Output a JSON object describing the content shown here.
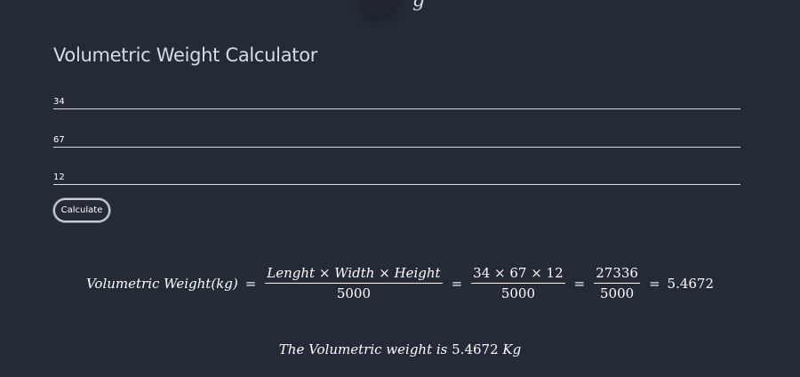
{
  "header": {
    "logo_glyph": "g"
  },
  "calculator": {
    "title": "Volumetric Weight Calculator",
    "inputs": [
      {
        "value": "34"
      },
      {
        "value": "67"
      },
      {
        "value": "12"
      }
    ],
    "button_label": "Calculate"
  },
  "formula": {
    "lhs": "Volumetric Weight(kg)",
    "eq": "=",
    "frac1_num": "Lenght × Width × Height",
    "frac1_den": "5000",
    "frac2_num": "34 × 67 × 12",
    "frac2_den": "5000",
    "frac3_num": "27336",
    "frac3_den": "5000",
    "result": "5.4672"
  },
  "result_line": {
    "prefix": "The Volumetric weight is ",
    "value": "5.4672",
    "unit": " Kg"
  }
}
